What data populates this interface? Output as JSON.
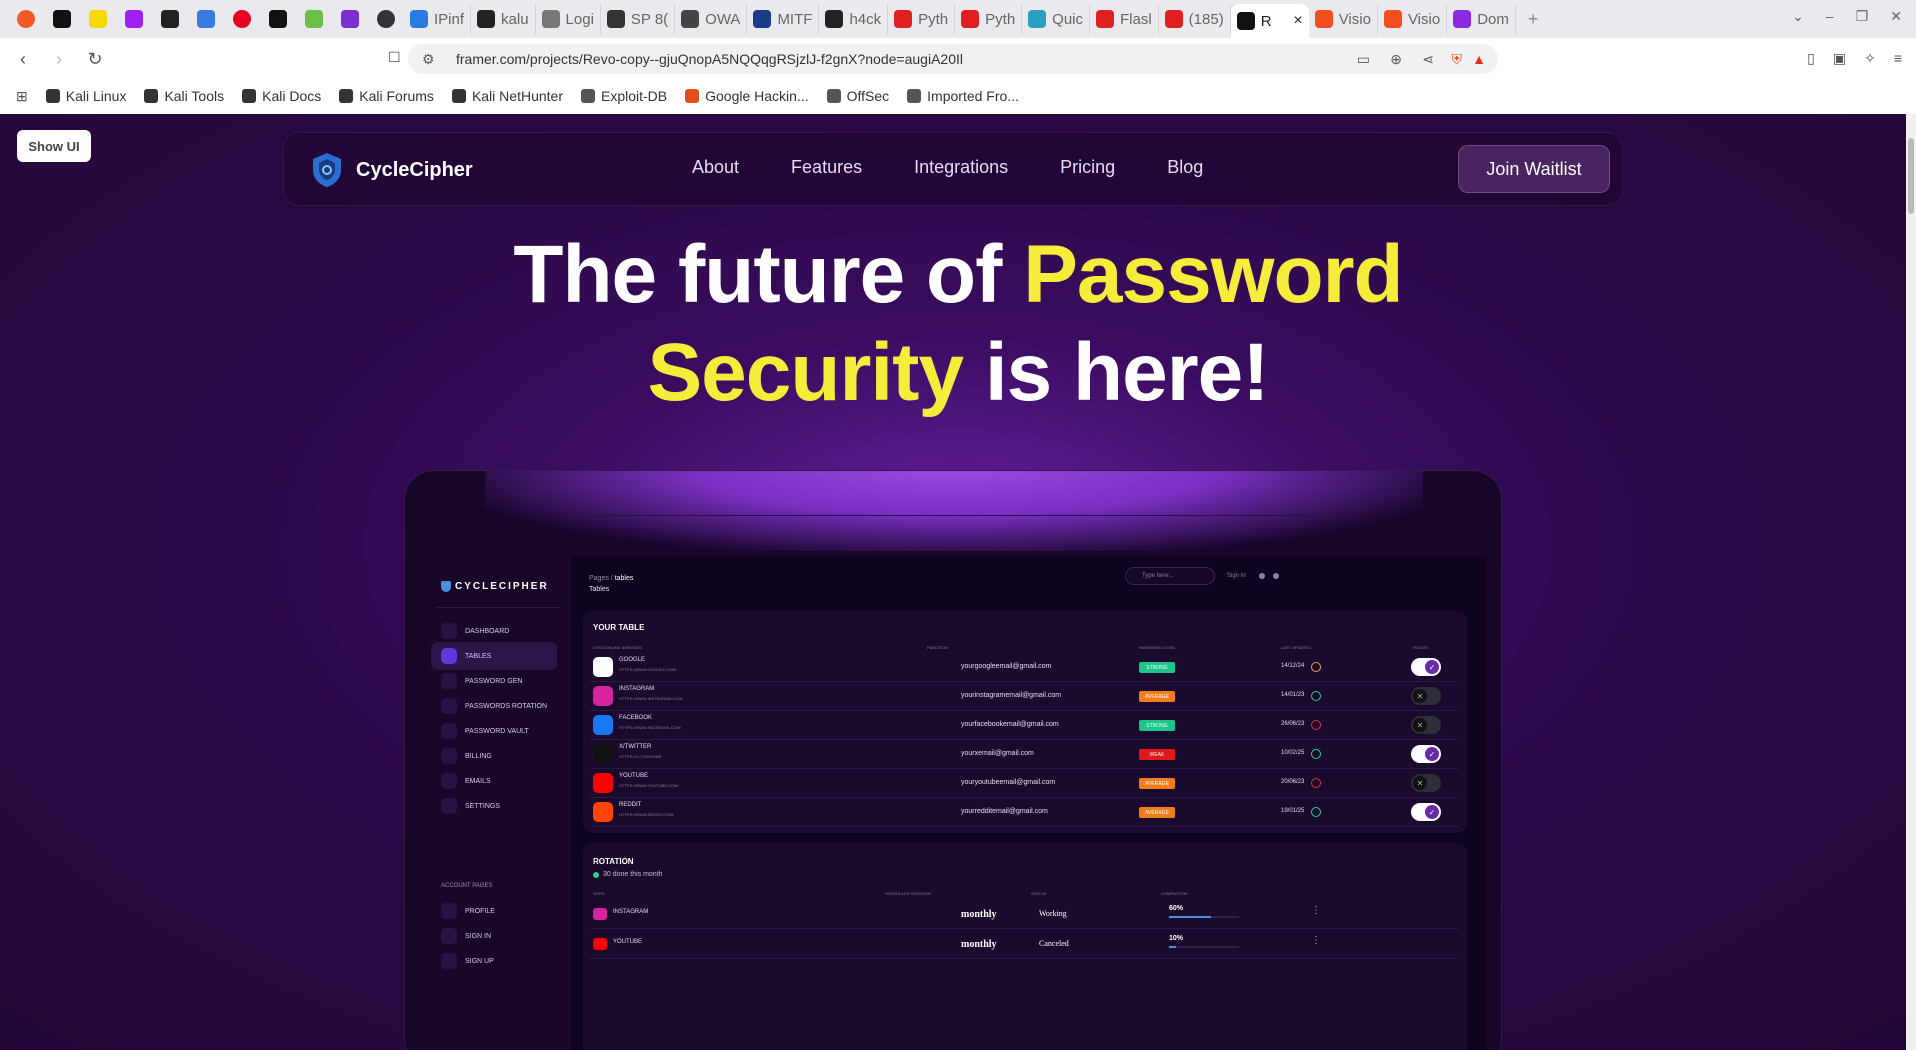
{
  "browser": {
    "tabs": [
      {
        "label": "IPinf",
        "color": "#2a7ae2"
      },
      {
        "label": "kalu",
        "color": "#222222"
      },
      {
        "label": "Logi",
        "color": "#777777"
      },
      {
        "label": "SP 8(",
        "color": "#333333"
      },
      {
        "label": "OWA",
        "color": "#444444"
      },
      {
        "label": "MITF",
        "color": "#1a3a8a"
      },
      {
        "label": "h4ck",
        "color": "#222222"
      },
      {
        "label": "Pyth",
        "color": "#e02020"
      },
      {
        "label": "Pyth",
        "color": "#e02020"
      },
      {
        "label": "Quic",
        "color": "#2aa0c0"
      },
      {
        "label": "Flasl",
        "color": "#e02020"
      },
      {
        "label": "(185)",
        "color": "#e02020"
      }
    ],
    "active_tab": {
      "label": "R",
      "close": "×"
    },
    "after_tabs": [
      {
        "label": "Visio",
        "color": "#f24e1e"
      },
      {
        "label": "Visio",
        "color": "#f24e1e"
      },
      {
        "label": "Dom",
        "color": "#8a2be2"
      }
    ],
    "new_tab": "+",
    "url": "framer.com/projects/Revo-copy--gjuQnopA5NQQqgRSjzlJ-f2gnX?node=augiA20Il",
    "bookmarks": [
      "Kali Linux",
      "Kali Tools",
      "Kali Docs",
      "Kali Forums",
      "Kali NetHunter",
      "Exploit-DB",
      "Google Hackin...",
      "OffSec",
      "Imported Fro..."
    ]
  },
  "canvas": {
    "show_ui": "Show UI"
  },
  "site": {
    "brand": "CycleCipher",
    "nav": [
      "About",
      "Features",
      "Integrations",
      "Pricing",
      "Blog"
    ],
    "cta": "Join Waitlist",
    "hero": {
      "line1_white": "The future of ",
      "line1_yellow": "Password",
      "line2_yellow": "Security",
      "line2_white": " is here!"
    },
    "colors": {
      "accent_yellow": "#f6ec3a",
      "bg_purple": "#2a0844"
    }
  },
  "dashboard": {
    "brand": "CYCLECIPHER",
    "sidebar": [
      "Dashboard",
      "Tables",
      "Password Gen",
      "Passwords Rotation",
      "Password vault",
      "Billing",
      "Emails",
      "Settings"
    ],
    "account_section": "ACCOUNT PAGES",
    "account_items": [
      "Profile",
      "Sign In",
      "Sign Up"
    ],
    "crumb_parent": "Pages",
    "crumb_sep": " / ",
    "crumb_current": "tables",
    "page_title": "Tables",
    "search_placeholder": "Type here...",
    "signin": "Sign In",
    "table": {
      "title": "Your Table",
      "headers": [
        "Sites/Online services",
        "Function",
        "Password Level",
        "Last updated",
        "Rotate"
      ],
      "rows": [
        {
          "name": "Google",
          "url": "https://www.google.com/",
          "email": "yourgoogleemail@gmail.com",
          "level": "Strong",
          "level_color": "#1ec58a",
          "date": "14/12/24",
          "emo_color": "#f2a23a",
          "rotate": true,
          "logo_color": "#ffffff"
        },
        {
          "name": "Instagram",
          "url": "https://www.instagram.com/",
          "email": "yourinstagramemail@gmail.com",
          "level": "Average",
          "level_color": "#f07d1a",
          "date": "14/01/23",
          "emo_color": "#2ad38a",
          "rotate": false,
          "logo_color": "#d6249f"
        },
        {
          "name": "Facebook",
          "url": "https://www.facebook.com/",
          "email": "yourfacebookemail@gmail.com",
          "level": "Strong",
          "level_color": "#1ec58a",
          "date": "26/06/23",
          "emo_color": "#e03030",
          "rotate": false,
          "logo_color": "#1877f2"
        },
        {
          "name": "X/Twitter",
          "url": "https://x.com/home",
          "email": "yourxemail@gmail.com",
          "level": "Weak",
          "level_color": "#e01818",
          "date": "10/02/25",
          "emo_color": "#2ad38a",
          "rotate": true,
          "logo_color": "#111111"
        },
        {
          "name": "Youtube",
          "url": "https://www.youtube.com/",
          "email": "youryoutubeemail@gmail.com",
          "level": "Average",
          "level_color": "#f07d1a",
          "date": "20/06/23",
          "emo_color": "#e03030",
          "rotate": false,
          "logo_color": "#ff0000"
        },
        {
          "name": "Reddit",
          "url": "https://www.reddit.com/",
          "email": "yourredditemail@gmail.com",
          "level": "Average",
          "level_color": "#f07d1a",
          "date": "19/01/25",
          "emo_color": "#2ad38a",
          "rotate": true,
          "logo_color": "#ff4500"
        }
      ]
    },
    "rotation": {
      "title": "Rotation",
      "subtitle": "30 done this month",
      "headers": [
        "Sites",
        "Scheduled Rotation",
        "Status",
        "Completion"
      ],
      "rows": [
        {
          "name": "Instagram",
          "schedule": "monthly",
          "status": "Working",
          "pct": "60%",
          "fill": 0.6,
          "logo_color": "#d6249f"
        },
        {
          "name": "Youtube",
          "schedule": "monthly",
          "status": "Canceled",
          "pct": "10%",
          "fill": 0.1,
          "logo_color": "#ff0000"
        }
      ]
    }
  }
}
